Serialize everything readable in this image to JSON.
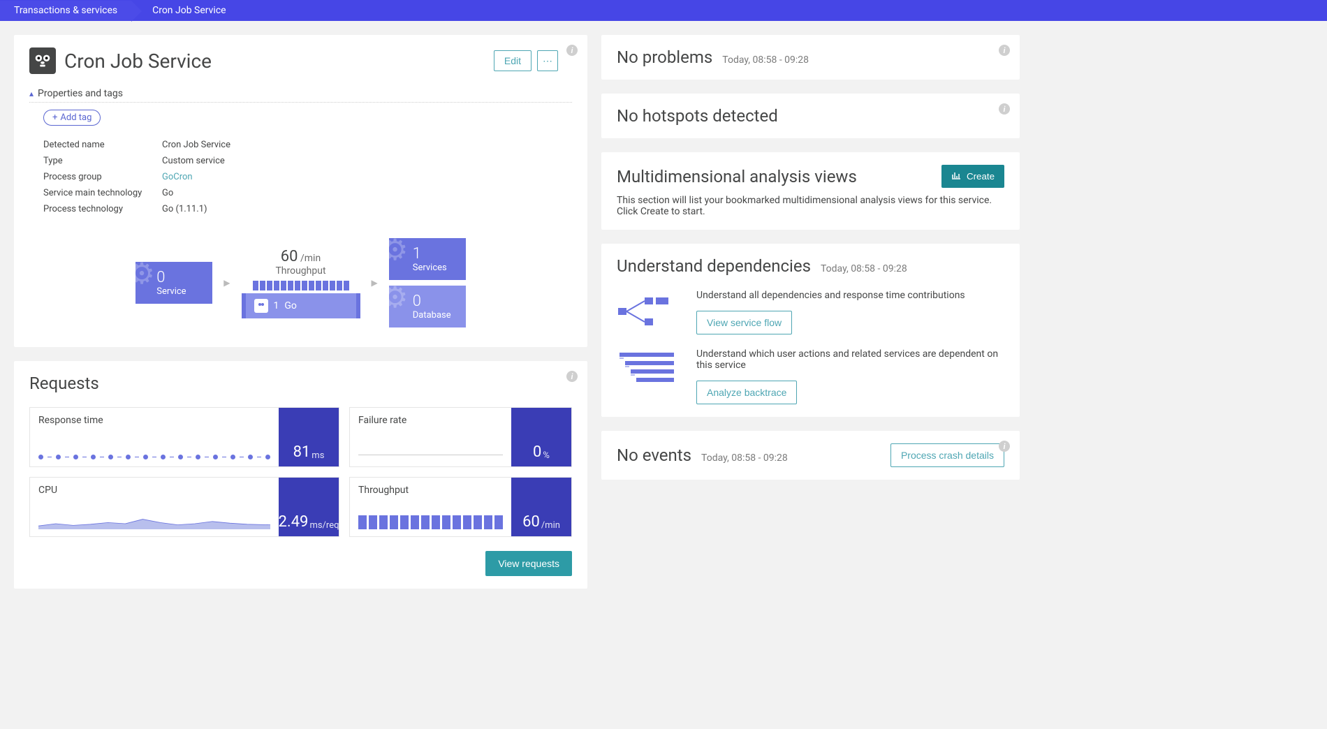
{
  "breadcrumb": {
    "root": "Transactions & services",
    "current": "Cron Job Service"
  },
  "service": {
    "title": "Cron Job Service",
    "edit_label": "Edit",
    "more_label": "⋯",
    "properties_toggle": "Properties and tags",
    "add_tag_label": "Add tag",
    "props": [
      {
        "label": "Detected name",
        "value": "Cron Job Service",
        "link": false
      },
      {
        "label": "Type",
        "value": "Custom service",
        "link": false
      },
      {
        "label": "Process group",
        "value": "GoCron",
        "link": true
      },
      {
        "label": "Service main technology",
        "value": "Go",
        "link": false
      },
      {
        "label": "Process technology",
        "value": "Go (1.11.1)",
        "link": false
      }
    ],
    "flow": {
      "incoming_count": "0",
      "incoming_label": "Service",
      "throughput_value": "60",
      "throughput_unit": "/min",
      "throughput_label": "Throughput",
      "tech_count": "1",
      "tech_label": "Go",
      "services_count": "1",
      "services_label": "Services",
      "db_count": "0",
      "db_label": "Database"
    }
  },
  "requests": {
    "title": "Requests",
    "metrics": {
      "response_time": {
        "title": "Response time",
        "value": "81",
        "unit": "ms"
      },
      "failure_rate": {
        "title": "Failure rate",
        "value": "0",
        "unit": "%"
      },
      "cpu": {
        "title": "CPU",
        "value": "2.49",
        "unit": "ms/req"
      },
      "throughput": {
        "title": "Throughput",
        "value": "60",
        "unit": "/min"
      }
    },
    "view_requests_label": "View requests"
  },
  "problems": {
    "title": "No problems",
    "timestamp": "Today, 08:58 - 09:28"
  },
  "hotspots": {
    "title": "No hotspots detected"
  },
  "mda": {
    "title": "Multidimensional analysis views",
    "create_label": "Create",
    "description": "This section will list your bookmarked multidimensional analysis views for this service. Click Create to start."
  },
  "dependencies": {
    "title": "Understand dependencies",
    "timestamp": "Today, 08:58 - 09:28",
    "flow_text": "Understand all dependencies and response time contributions",
    "flow_button": "View service flow",
    "backtrace_text": "Understand which user actions and related services are dependent on this service",
    "backtrace_button": "Analyze backtrace"
  },
  "events": {
    "title": "No events",
    "timestamp": "Today, 08:58 - 09:28",
    "crash_button": "Process crash details"
  },
  "chart_data": [
    {
      "type": "line",
      "title": "Response time",
      "values": [
        80,
        82,
        81,
        80,
        79,
        81,
        82,
        83,
        81,
        80,
        81,
        82,
        81,
        80,
        82,
        81
      ],
      "ylim": [
        0,
        120
      ],
      "unit": "ms"
    },
    {
      "type": "line",
      "title": "Failure rate",
      "values": [
        0,
        0,
        0,
        0,
        0,
        0,
        0,
        0,
        0,
        0,
        0,
        0,
        0,
        0,
        0,
        0
      ],
      "ylim": [
        0,
        100
      ],
      "unit": "%"
    },
    {
      "type": "area",
      "title": "CPU",
      "values": [
        1.8,
        2.2,
        2.0,
        1.9,
        2.6,
        2.3,
        3.4,
        2.5,
        2.0,
        2.2,
        2.8,
        2.4,
        2.49
      ],
      "ylim": [
        0,
        5
      ],
      "unit": "ms/req"
    },
    {
      "type": "bar",
      "title": "Throughput",
      "values": [
        60,
        60,
        60,
        60,
        60,
        60,
        60,
        60,
        60,
        60,
        60,
        60,
        60,
        60
      ],
      "ylim": [
        0,
        80
      ],
      "unit": "/min"
    }
  ]
}
